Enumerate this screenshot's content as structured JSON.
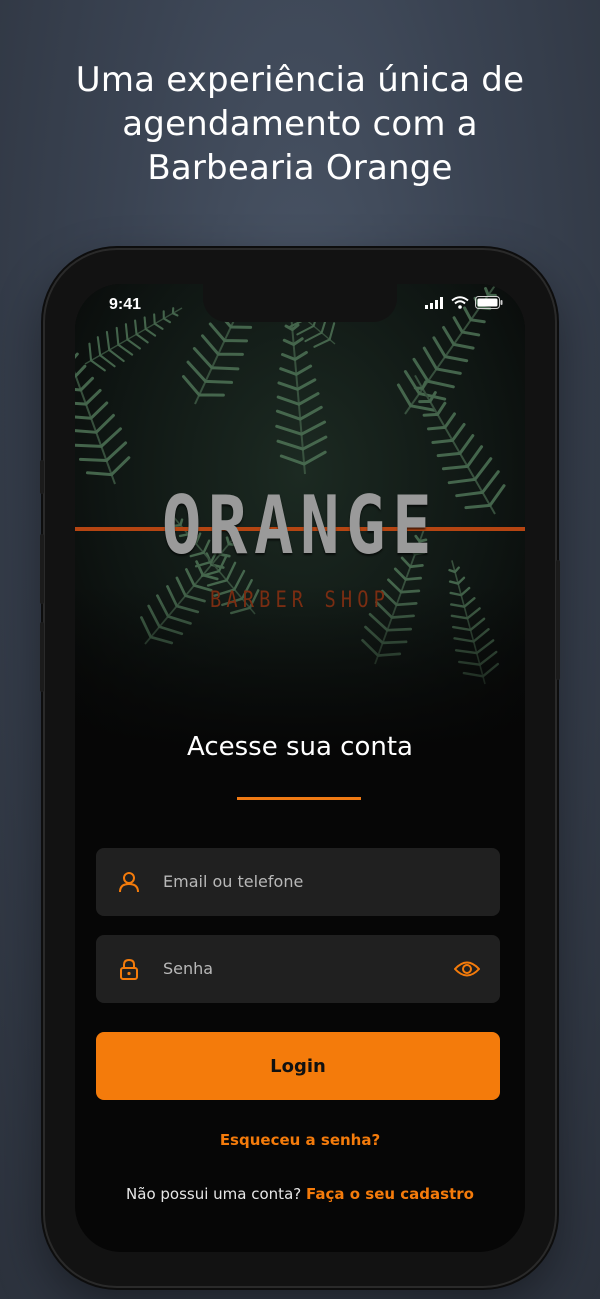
{
  "headline": {
    "line1": "Uma experiência única de",
    "line2": "agendamento com a",
    "line3": "Barbearia Orange"
  },
  "status_bar": {
    "time": "9:41",
    "icons": [
      "cellular-signal-icon",
      "wifi-icon",
      "battery-icon"
    ]
  },
  "brand": {
    "name": "ORANGE",
    "subtitle": "BARBER SHOP"
  },
  "login_screen": {
    "title": "Acesse sua conta",
    "email_field": {
      "placeholder": "Email ou telefone",
      "icon": "user-icon"
    },
    "password_field": {
      "placeholder": "Senha",
      "icon": "lock-icon",
      "toggle_icon": "eye-icon"
    },
    "login_button": "Login",
    "forgot_password": "Esqueceu a senha?",
    "signup_prompt": "Não possui uma conta?",
    "signup_link": "Faça o seu cadastro"
  },
  "colors": {
    "accent": "#f47b0b",
    "field_bg": "#202020",
    "screen_bg": "#060606",
    "brand_bar": "#b54512"
  }
}
